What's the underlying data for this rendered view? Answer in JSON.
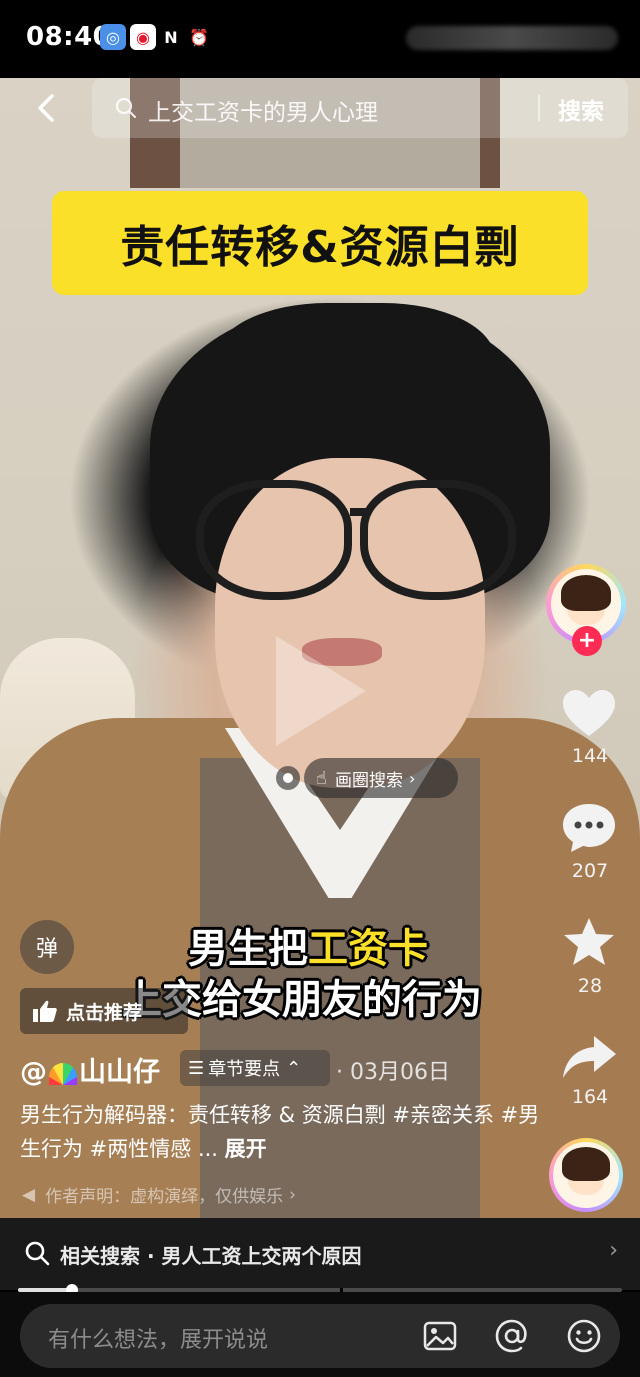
{
  "status_bar": {
    "time": "08:40"
  },
  "search": {
    "query": "上交工资卡的男人心理",
    "button_label": "搜索"
  },
  "video": {
    "banner_title": "责任转移&资源白剽",
    "circle_search_label": "画圈搜索",
    "subtitle_line1_pre": "男生把",
    "subtitle_line1_highlight": "工资卡",
    "subtitle_line2": "上交给女朋友的行为"
  },
  "rail": {
    "likes": "144",
    "comments": "207",
    "favorites": "28",
    "shares": "164",
    "follow_symbol": "+"
  },
  "left_controls": {
    "danmu_label": "弹",
    "recommend_label": "点击推荐"
  },
  "author": {
    "at": "@",
    "name": "山山仔",
    "chapters_label": "章节要点",
    "date": "· 03月06日"
  },
  "description": {
    "text": "男生行为解码器：责任转移 & 资源白剽 #亲密关系 #男生行为 #两性情感 ...",
    "expand_label": "展开"
  },
  "disclaimer": {
    "text": "作者声明：虚构演绎，仅供娱乐"
  },
  "related_search": {
    "label": "相关搜索 · 男人工资上交两个原因"
  },
  "progress": {
    "played_fraction": 0.09
  },
  "comment_bar": {
    "placeholder": "有什么想法，展开说说"
  },
  "colors": {
    "banner_yellow": "#fbe02a",
    "follow_red": "#fe2c55"
  },
  "icons": {
    "back": "chevron-left-icon",
    "search": "search-icon",
    "heart": "heart-icon",
    "comment": "comment-bubble-icon",
    "favorite": "star-icon",
    "share": "share-arrow-icon",
    "thumb": "thumbs-up-icon",
    "image": "image-icon",
    "mention": "at-icon",
    "emoji": "emoji-icon"
  }
}
